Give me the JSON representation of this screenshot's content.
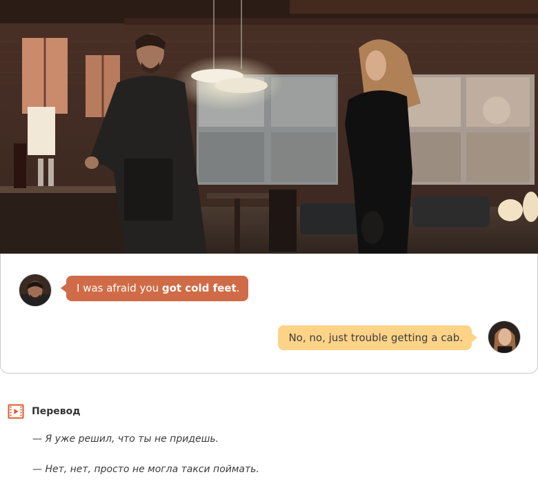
{
  "scene": {
    "alt": "Scene from the film"
  },
  "dialogue": [
    {
      "speaker": "man",
      "side": "left",
      "text_before": "I was afraid you ",
      "text_bold": "got cold feet",
      "text_after": ".",
      "bubble_color": "#d06b47"
    },
    {
      "speaker": "woman",
      "side": "right",
      "text": "No, no, just trouble getting a cab.",
      "bubble_color": "#fdd387"
    }
  ],
  "translation": {
    "icon": "film-play-icon",
    "icon_color": "#e0582f",
    "title": "Перевод",
    "lines": [
      "— Я уже решил, что ты не придешь.",
      "— Нет, нет, просто не могла такси поймать."
    ]
  }
}
